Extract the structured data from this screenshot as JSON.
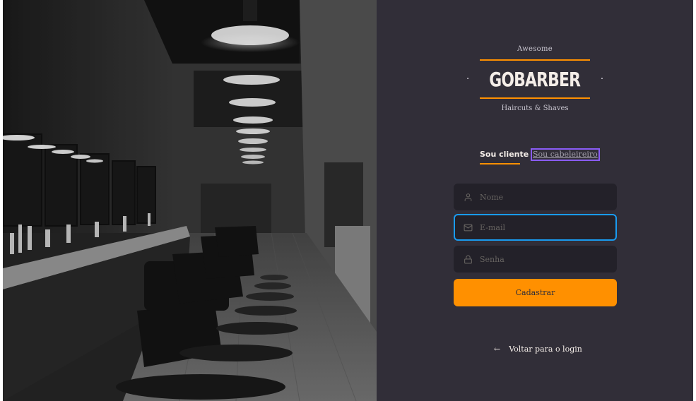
{
  "logo": {
    "top_text": "Awesome",
    "brand": "GOBARBER",
    "dot": "·",
    "tagline": "Haircuts & Shaves"
  },
  "tabs": {
    "client": "Sou cliente",
    "barber": "Sou cabeleireiro"
  },
  "form": {
    "name_placeholder": "Nome",
    "email_placeholder": "E-mail",
    "password_placeholder": "Senha",
    "submit_label": "Cadastrar"
  },
  "back_link": {
    "arrow": "←",
    "label": "Voltar para o login"
  },
  "colors": {
    "accent": "#ff9000",
    "background": "#312e38",
    "input_background": "#232129",
    "focus_border": "#199bf0",
    "tab_focus_border": "#8a5cf6"
  },
  "icons": {
    "name_field": "user-icon",
    "email_field": "mail-icon",
    "password_field": "lock-icon",
    "back": "arrow-left-icon"
  }
}
